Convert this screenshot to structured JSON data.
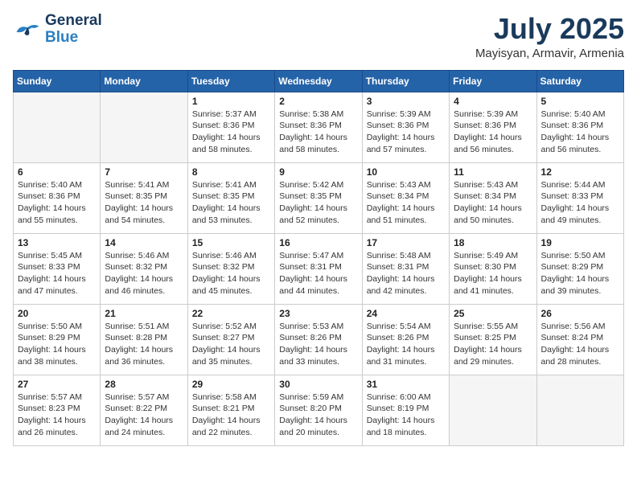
{
  "header": {
    "logo_general": "General",
    "logo_blue": "Blue",
    "month_title": "July 2025",
    "location": "Mayisyan, Armavir, Armenia"
  },
  "weekdays": [
    "Sunday",
    "Monday",
    "Tuesday",
    "Wednesday",
    "Thursday",
    "Friday",
    "Saturday"
  ],
  "weeks": [
    [
      {
        "day": "",
        "sunrise": "",
        "sunset": "",
        "daylight": ""
      },
      {
        "day": "",
        "sunrise": "",
        "sunset": "",
        "daylight": ""
      },
      {
        "day": "1",
        "sunrise": "Sunrise: 5:37 AM",
        "sunset": "Sunset: 8:36 PM",
        "daylight": "Daylight: 14 hours and 58 minutes."
      },
      {
        "day": "2",
        "sunrise": "Sunrise: 5:38 AM",
        "sunset": "Sunset: 8:36 PM",
        "daylight": "Daylight: 14 hours and 58 minutes."
      },
      {
        "day": "3",
        "sunrise": "Sunrise: 5:39 AM",
        "sunset": "Sunset: 8:36 PM",
        "daylight": "Daylight: 14 hours and 57 minutes."
      },
      {
        "day": "4",
        "sunrise": "Sunrise: 5:39 AM",
        "sunset": "Sunset: 8:36 PM",
        "daylight": "Daylight: 14 hours and 56 minutes."
      },
      {
        "day": "5",
        "sunrise": "Sunrise: 5:40 AM",
        "sunset": "Sunset: 8:36 PM",
        "daylight": "Daylight: 14 hours and 56 minutes."
      }
    ],
    [
      {
        "day": "6",
        "sunrise": "Sunrise: 5:40 AM",
        "sunset": "Sunset: 8:36 PM",
        "daylight": "Daylight: 14 hours and 55 minutes."
      },
      {
        "day": "7",
        "sunrise": "Sunrise: 5:41 AM",
        "sunset": "Sunset: 8:35 PM",
        "daylight": "Daylight: 14 hours and 54 minutes."
      },
      {
        "day": "8",
        "sunrise": "Sunrise: 5:41 AM",
        "sunset": "Sunset: 8:35 PM",
        "daylight": "Daylight: 14 hours and 53 minutes."
      },
      {
        "day": "9",
        "sunrise": "Sunrise: 5:42 AM",
        "sunset": "Sunset: 8:35 PM",
        "daylight": "Daylight: 14 hours and 52 minutes."
      },
      {
        "day": "10",
        "sunrise": "Sunrise: 5:43 AM",
        "sunset": "Sunset: 8:34 PM",
        "daylight": "Daylight: 14 hours and 51 minutes."
      },
      {
        "day": "11",
        "sunrise": "Sunrise: 5:43 AM",
        "sunset": "Sunset: 8:34 PM",
        "daylight": "Daylight: 14 hours and 50 minutes."
      },
      {
        "day": "12",
        "sunrise": "Sunrise: 5:44 AM",
        "sunset": "Sunset: 8:33 PM",
        "daylight": "Daylight: 14 hours and 49 minutes."
      }
    ],
    [
      {
        "day": "13",
        "sunrise": "Sunrise: 5:45 AM",
        "sunset": "Sunset: 8:33 PM",
        "daylight": "Daylight: 14 hours and 47 minutes."
      },
      {
        "day": "14",
        "sunrise": "Sunrise: 5:46 AM",
        "sunset": "Sunset: 8:32 PM",
        "daylight": "Daylight: 14 hours and 46 minutes."
      },
      {
        "day": "15",
        "sunrise": "Sunrise: 5:46 AM",
        "sunset": "Sunset: 8:32 PM",
        "daylight": "Daylight: 14 hours and 45 minutes."
      },
      {
        "day": "16",
        "sunrise": "Sunrise: 5:47 AM",
        "sunset": "Sunset: 8:31 PM",
        "daylight": "Daylight: 14 hours and 44 minutes."
      },
      {
        "day": "17",
        "sunrise": "Sunrise: 5:48 AM",
        "sunset": "Sunset: 8:31 PM",
        "daylight": "Daylight: 14 hours and 42 minutes."
      },
      {
        "day": "18",
        "sunrise": "Sunrise: 5:49 AM",
        "sunset": "Sunset: 8:30 PM",
        "daylight": "Daylight: 14 hours and 41 minutes."
      },
      {
        "day": "19",
        "sunrise": "Sunrise: 5:50 AM",
        "sunset": "Sunset: 8:29 PM",
        "daylight": "Daylight: 14 hours and 39 minutes."
      }
    ],
    [
      {
        "day": "20",
        "sunrise": "Sunrise: 5:50 AM",
        "sunset": "Sunset: 8:29 PM",
        "daylight": "Daylight: 14 hours and 38 minutes."
      },
      {
        "day": "21",
        "sunrise": "Sunrise: 5:51 AM",
        "sunset": "Sunset: 8:28 PM",
        "daylight": "Daylight: 14 hours and 36 minutes."
      },
      {
        "day": "22",
        "sunrise": "Sunrise: 5:52 AM",
        "sunset": "Sunset: 8:27 PM",
        "daylight": "Daylight: 14 hours and 35 minutes."
      },
      {
        "day": "23",
        "sunrise": "Sunrise: 5:53 AM",
        "sunset": "Sunset: 8:26 PM",
        "daylight": "Daylight: 14 hours and 33 minutes."
      },
      {
        "day": "24",
        "sunrise": "Sunrise: 5:54 AM",
        "sunset": "Sunset: 8:26 PM",
        "daylight": "Daylight: 14 hours and 31 minutes."
      },
      {
        "day": "25",
        "sunrise": "Sunrise: 5:55 AM",
        "sunset": "Sunset: 8:25 PM",
        "daylight": "Daylight: 14 hours and 29 minutes."
      },
      {
        "day": "26",
        "sunrise": "Sunrise: 5:56 AM",
        "sunset": "Sunset: 8:24 PM",
        "daylight": "Daylight: 14 hours and 28 minutes."
      }
    ],
    [
      {
        "day": "27",
        "sunrise": "Sunrise: 5:57 AM",
        "sunset": "Sunset: 8:23 PM",
        "daylight": "Daylight: 14 hours and 26 minutes."
      },
      {
        "day": "28",
        "sunrise": "Sunrise: 5:57 AM",
        "sunset": "Sunset: 8:22 PM",
        "daylight": "Daylight: 14 hours and 24 minutes."
      },
      {
        "day": "29",
        "sunrise": "Sunrise: 5:58 AM",
        "sunset": "Sunset: 8:21 PM",
        "daylight": "Daylight: 14 hours and 22 minutes."
      },
      {
        "day": "30",
        "sunrise": "Sunrise: 5:59 AM",
        "sunset": "Sunset: 8:20 PM",
        "daylight": "Daylight: 14 hours and 20 minutes."
      },
      {
        "day": "31",
        "sunrise": "Sunrise: 6:00 AM",
        "sunset": "Sunset: 8:19 PM",
        "daylight": "Daylight: 14 hours and 18 minutes."
      },
      {
        "day": "",
        "sunrise": "",
        "sunset": "",
        "daylight": ""
      },
      {
        "day": "",
        "sunrise": "",
        "sunset": "",
        "daylight": ""
      }
    ]
  ]
}
